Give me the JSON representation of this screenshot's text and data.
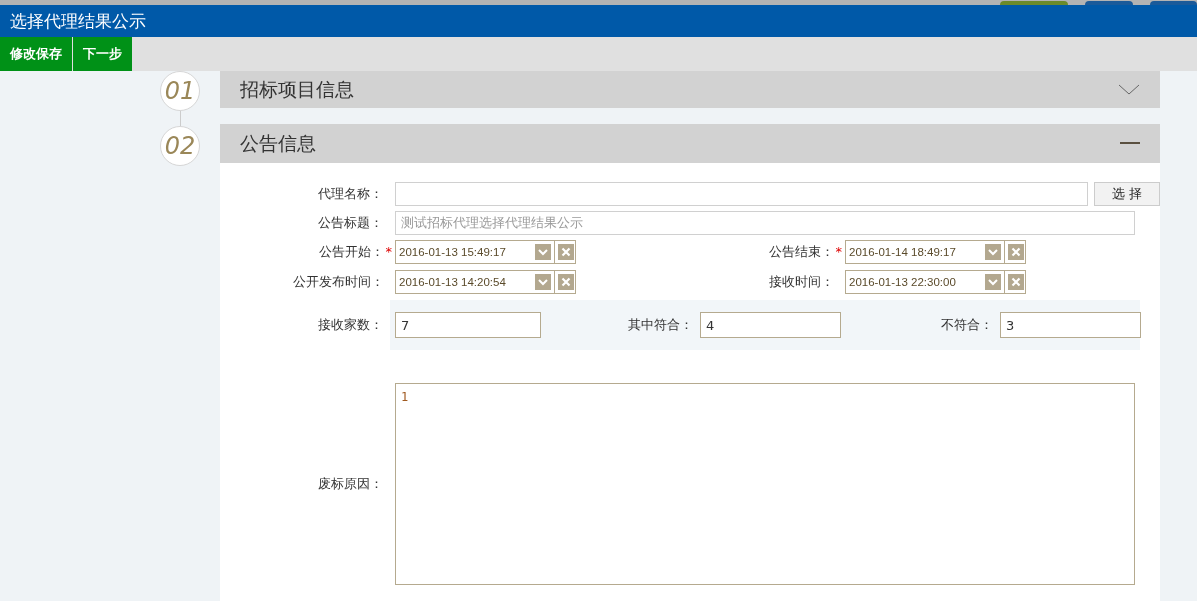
{
  "window": {
    "title": "选择代理结果公示"
  },
  "toolbar": [
    "修改保存",
    "下一步"
  ],
  "sections": [
    {
      "number": "01",
      "title": "招标项目信息",
      "expanded": false
    },
    {
      "number": "02",
      "title": "公告信息",
      "expanded": true
    }
  ],
  "form": {
    "agent": {
      "label": "代理名称：",
      "button": "选 择"
    },
    "title": {
      "label": "公告标题：",
      "value": "测试招标代理选择代理结果公示",
      "disabled": true
    },
    "date_rows": [
      [
        {
          "label": "公告开始：",
          "required_mark": "*",
          "value": "2016-01-13 15:49:17"
        },
        {
          "label": "公告结束：",
          "required_mark": "*",
          "value": "2016-01-14 18:49:17"
        }
      ],
      [
        {
          "label": "公开发布时间：",
          "value": "2016-01-13 14:20:54"
        },
        {
          "label": "接收时间：",
          "value": "2016-01-13 22:30:00"
        }
      ]
    ],
    "counts": [
      {
        "label": "接收家数：",
        "value": "7"
      },
      {
        "label": "其中符合：",
        "value": "4"
      },
      {
        "label": "不符合：",
        "value": "3"
      }
    ],
    "reason": {
      "label": "废标原因：",
      "value": "1"
    }
  }
}
